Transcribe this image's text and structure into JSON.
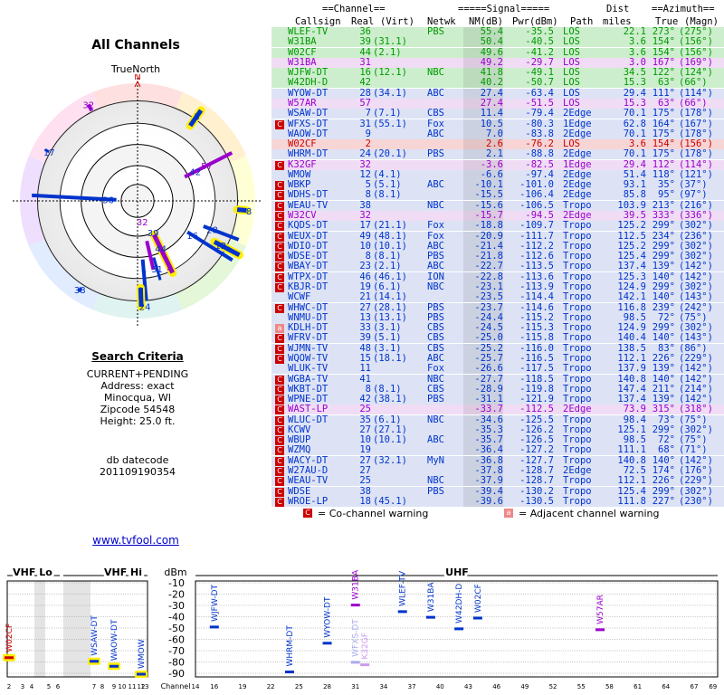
{
  "title": "All Channels",
  "true_north": "TrueNorth",
  "north_letter": "N",
  "search_criteria": {
    "heading": "Search Criteria",
    "lines": [
      "CURRENT+PENDING",
      "Address: exact",
      "Minocqua, WI",
      "Zipcode 54548",
      "Height: 25.0 ft."
    ]
  },
  "db_datecode_label": "db datecode",
  "db_datecode": "201109190354",
  "link": "www.tvfool.com",
  "table_headers": {
    "group_channel": "==Channel==",
    "group_signal": "=====Signal=====",
    "group_dist": "Dist",
    "group_azimuth": "==Azimuth==",
    "callsign": "Callsign",
    "real": "Real",
    "virt": "(Virt)",
    "netwk": "Netwk",
    "nm": "NM(dB)",
    "pwr": "Pwr(dBm)",
    "path": "Path",
    "miles": "miles",
    "true": "True",
    "magn": "(Magn)"
  },
  "legend": {
    "co_mark": "C",
    "co_text": "= Co-channel warning",
    "adj_mark": "a",
    "adj_text": "= Adjacent channel warning"
  },
  "colors": {
    "green": "#009900",
    "blue": "#0033cc",
    "purple": "#9900cc",
    "orange": "#cc6600",
    "red": "#cc0000",
    "olive": "#888800",
    "magenta": "#cc0099"
  },
  "stations": [
    {
      "call": "WLEF-TV",
      "real": "36",
      "virt": "",
      "net": "PBS",
      "nm": "55.4",
      "pwr": "-35.5",
      "path": "LOS",
      "dist": "22.1",
      "az": "273°",
      "mag": "(275°)",
      "color": "#009900",
      "warn": ""
    },
    {
      "call": "W31BA",
      "real": "39",
      "virt": "(31.1)",
      "net": "",
      "nm": "50.4",
      "pwr": "-40.5",
      "path": "LOS",
      "dist": "3.6",
      "az": "154°",
      "mag": "(156°)",
      "color": "#009900",
      "warn": ""
    },
    {
      "call": "W02CF",
      "real": "44",
      "virt": "(2.1)",
      "net": "",
      "nm": "49.6",
      "pwr": "-41.2",
      "path": "LOS",
      "dist": "3.6",
      "az": "154°",
      "mag": "(156°)",
      "color": "#009900",
      "warn": ""
    },
    {
      "call": "W31BA",
      "real": "31",
      "virt": "",
      "net": "",
      "nm": "49.2",
      "pwr": "-29.7",
      "path": "LOS",
      "dist": "3.0",
      "az": "167°",
      "mag": "(169°)",
      "color": "#9900cc",
      "warn": ""
    },
    {
      "call": "WJFW-DT",
      "real": "16",
      "virt": "(12.1)",
      "net": "NBC",
      "nm": "41.8",
      "pwr": "-49.1",
      "path": "LOS",
      "dist": "34.5",
      "az": "122°",
      "mag": "(124°)",
      "color": "#009900",
      "warn": ""
    },
    {
      "call": "W42DH-D",
      "real": "42",
      "virt": "",
      "net": "",
      "nm": "40.2",
      "pwr": "-50.7",
      "path": "LOS",
      "dist": "15.3",
      "az": "63°",
      "mag": "(66°)",
      "color": "#009900",
      "warn": ""
    },
    {
      "call": "WYOW-DT",
      "real": "28",
      "virt": "(34.1)",
      "net": "ABC",
      "nm": "27.4",
      "pwr": "-63.4",
      "path": "LOS",
      "dist": "29.4",
      "az": "111°",
      "mag": "(114°)",
      "color": "#0033cc",
      "warn": ""
    },
    {
      "call": "W57AR",
      "real": "57",
      "virt": "",
      "net": "",
      "nm": "27.4",
      "pwr": "-51.5",
      "path": "LOS",
      "dist": "15.3",
      "az": "63°",
      "mag": "(66°)",
      "color": "#9900cc",
      "warn": ""
    },
    {
      "call": "WSAW-DT",
      "real": "7",
      "virt": "(7.1)",
      "net": "CBS",
      "nm": "11.4",
      "pwr": "-79.4",
      "path": "2Edge",
      "dist": "70.1",
      "az": "175°",
      "mag": "(178°)",
      "color": "#0033cc",
      "warn": ""
    },
    {
      "call": "WFXS-DT",
      "real": "31",
      "virt": "(55.1)",
      "net": "Fox",
      "nm": "10.5",
      "pwr": "-80.3",
      "path": "1Edge",
      "dist": "62.8",
      "az": "164°",
      "mag": "(167°)",
      "color": "#0033cc",
      "warn": "C"
    },
    {
      "call": "WAOW-DT",
      "real": "9",
      "virt": "",
      "net": "ABC",
      "nm": "7.0",
      "pwr": "-83.8",
      "path": "2Edge",
      "dist": "70.1",
      "az": "175°",
      "mag": "(178°)",
      "color": "#0033cc",
      "warn": ""
    },
    {
      "call": "W02CF",
      "real": "2",
      "virt": "",
      "net": "",
      "nm": "2.6",
      "pwr": "-76.2",
      "path": "LOS",
      "dist": "3.6",
      "az": "154°",
      "mag": "(156°)",
      "color": "#cc0000",
      "warn": ""
    },
    {
      "call": "WHRM-DT",
      "real": "24",
      "virt": "(20.1)",
      "net": "PBS",
      "nm": "2.1",
      "pwr": "-88.8",
      "path": "2Edge",
      "dist": "70.1",
      "az": "175°",
      "mag": "(178°)",
      "color": "#0033cc",
      "warn": ""
    },
    {
      "call": "K32GF",
      "real": "32",
      "virt": "",
      "net": "",
      "nm": "-3.6",
      "pwr": "-82.5",
      "path": "1Edge",
      "dist": "29.4",
      "az": "112°",
      "mag": "(114°)",
      "color": "#9900cc",
      "warn": "C"
    },
    {
      "call": "WMOW",
      "real": "12",
      "virt": "(4.1)",
      "net": "",
      "nm": "-6.6",
      "pwr": "-97.4",
      "path": "2Edge",
      "dist": "51.4",
      "az": "118°",
      "mag": "(121°)",
      "color": "#0033cc",
      "warn": ""
    },
    {
      "call": "WBKP",
      "real": "5",
      "virt": "(5.1)",
      "net": "ABC",
      "nm": "-10.1",
      "pwr": "-101.0",
      "path": "2Edge",
      "dist": "93.1",
      "az": "35°",
      "mag": "(37°)",
      "color": "#0033cc",
      "warn": "C"
    },
    {
      "call": "WDHS-DT",
      "real": "8",
      "virt": "(8.1)",
      "net": "",
      "nm": "-15.5",
      "pwr": "-106.4",
      "path": "2Edge",
      "dist": "85.8",
      "az": "95°",
      "mag": "(97°)",
      "color": "#0033cc",
      "warn": "C"
    },
    {
      "call": "WEAU-TV",
      "real": "38",
      "virt": "",
      "net": "NBC",
      "nm": "-15.6",
      "pwr": "-106.5",
      "path": "Tropo",
      "dist": "103.9",
      "az": "213°",
      "mag": "(216°)",
      "color": "#0033cc",
      "warn": "C"
    },
    {
      "call": "W32CV",
      "real": "32",
      "virt": "",
      "net": "",
      "nm": "-15.7",
      "pwr": "-94.5",
      "path": "2Edge",
      "dist": "39.5",
      "az": "333°",
      "mag": "(336°)",
      "color": "#9900cc",
      "warn": "C"
    },
    {
      "call": "KQDS-DT",
      "real": "17",
      "virt": "(21.1)",
      "net": "Fox",
      "nm": "-18.8",
      "pwr": "-109.7",
      "path": "Tropo",
      "dist": "125.2",
      "az": "299°",
      "mag": "(302°)",
      "color": "#0033cc",
      "warn": "C"
    },
    {
      "call": "WEUX-DT",
      "real": "49",
      "virt": "(48.1)",
      "net": "Fox",
      "nm": "-20.9",
      "pwr": "-111.7",
      "path": "Tropo",
      "dist": "112.5",
      "az": "234°",
      "mag": "(236°)",
      "color": "#0033cc",
      "warn": "C"
    },
    {
      "call": "WDIO-DT",
      "real": "10",
      "virt": "(10.1)",
      "net": "ABC",
      "nm": "-21.4",
      "pwr": "-112.2",
      "path": "Tropo",
      "dist": "125.2",
      "az": "299°",
      "mag": "(302°)",
      "color": "#0033cc",
      "warn": "C"
    },
    {
      "call": "WDSE-DT",
      "real": "8",
      "virt": "(8.1)",
      "net": "PBS",
      "nm": "-21.8",
      "pwr": "-112.6",
      "path": "Tropo",
      "dist": "125.4",
      "az": "299°",
      "mag": "(302°)",
      "color": "#0033cc",
      "warn": "C"
    },
    {
      "call": "WBAY-DT",
      "real": "23",
      "virt": "(2.1)",
      "net": "ABC",
      "nm": "-22.7",
      "pwr": "-113.5",
      "path": "Tropo",
      "dist": "137.4",
      "az": "139°",
      "mag": "(142°)",
      "color": "#0033cc",
      "warn": "C"
    },
    {
      "call": "WTPX-DT",
      "real": "46",
      "virt": "(46.1)",
      "net": "ION",
      "nm": "-22.8",
      "pwr": "-113.6",
      "path": "Tropo",
      "dist": "125.3",
      "az": "140°",
      "mag": "(142°)",
      "color": "#0033cc",
      "warn": "C"
    },
    {
      "call": "KBJR-DT",
      "real": "19",
      "virt": "(6.1)",
      "net": "NBC",
      "nm": "-23.1",
      "pwr": "-113.9",
      "path": "Tropo",
      "dist": "124.9",
      "az": "299°",
      "mag": "(302°)",
      "color": "#0033cc",
      "warn": "C"
    },
    {
      "call": "WCWF",
      "real": "21",
      "virt": "(14.1)",
      "net": "",
      "nm": "-23.5",
      "pwr": "-114.4",
      "path": "Tropo",
      "dist": "142.1",
      "az": "140°",
      "mag": "(143°)",
      "color": "#0033cc",
      "warn": ""
    },
    {
      "call": "WHWC-DT",
      "real": "27",
      "virt": "(28.1)",
      "net": "PBS",
      "nm": "-23.7",
      "pwr": "-114.6",
      "path": "Tropo",
      "dist": "116.8",
      "az": "239°",
      "mag": "(242°)",
      "color": "#0033cc",
      "warn": "C"
    },
    {
      "call": "WNMU-DT",
      "real": "13",
      "virt": "(13.1)",
      "net": "PBS",
      "nm": "-24.4",
      "pwr": "-115.2",
      "path": "Tropo",
      "dist": "98.5",
      "az": "72°",
      "mag": "(75°)",
      "color": "#0033cc",
      "warn": ""
    },
    {
      "call": "KDLH-DT",
      "real": "33",
      "virt": "(3.1)",
      "net": "CBS",
      "nm": "-24.5",
      "pwr": "-115.3",
      "path": "Tropo",
      "dist": "124.9",
      "az": "299°",
      "mag": "(302°)",
      "color": "#0033cc",
      "warn": "a"
    },
    {
      "call": "WFRV-DT",
      "real": "39",
      "virt": "(5.1)",
      "net": "CBS",
      "nm": "-25.0",
      "pwr": "-115.8",
      "path": "Tropo",
      "dist": "140.4",
      "az": "140°",
      "mag": "(143°)",
      "color": "#0033cc",
      "warn": "C"
    },
    {
      "call": "WJMN-TV",
      "real": "48",
      "virt": "(3.1)",
      "net": "CBS",
      "nm": "-25.2",
      "pwr": "-116.0",
      "path": "Tropo",
      "dist": "138.5",
      "az": "83°",
      "mag": "(86°)",
      "color": "#0033cc",
      "warn": "C"
    },
    {
      "call": "WQOW-TV",
      "real": "15",
      "virt": "(18.1)",
      "net": "ABC",
      "nm": "-25.7",
      "pwr": "-116.5",
      "path": "Tropo",
      "dist": "112.1",
      "az": "226°",
      "mag": "(229°)",
      "color": "#0033cc",
      "warn": "C"
    },
    {
      "call": "WLUK-TV",
      "real": "11",
      "virt": "",
      "net": "Fox",
      "nm": "-26.6",
      "pwr": "-117.5",
      "path": "Tropo",
      "dist": "137.9",
      "az": "139°",
      "mag": "(142°)",
      "color": "#0033cc",
      "warn": ""
    },
    {
      "call": "WGBA-TV",
      "real": "41",
      "virt": "",
      "net": "NBC",
      "nm": "-27.7",
      "pwr": "-118.5",
      "path": "Tropo",
      "dist": "140.8",
      "az": "140°",
      "mag": "(142°)",
      "color": "#0033cc",
      "warn": "C"
    },
    {
      "call": "WKBT-DT",
      "real": "8",
      "virt": "(8.1)",
      "net": "CBS",
      "nm": "-28.9",
      "pwr": "-119.8",
      "path": "Tropo",
      "dist": "147.4",
      "az": "211°",
      "mag": "(214°)",
      "color": "#0033cc",
      "warn": "C"
    },
    {
      "call": "WPNE-DT",
      "real": "42",
      "virt": "(38.1)",
      "net": "PBS",
      "nm": "-31.1",
      "pwr": "-121.9",
      "path": "Tropo",
      "dist": "137.4",
      "az": "139°",
      "mag": "(142°)",
      "color": "#0033cc",
      "warn": "C"
    },
    {
      "call": "WAST-LP",
      "real": "25",
      "virt": "",
      "net": "",
      "nm": "-33.7",
      "pwr": "-112.5",
      "path": "2Edge",
      "dist": "73.9",
      "az": "315°",
      "mag": "(318°)",
      "color": "#9900cc",
      "warn": "C"
    },
    {
      "call": "WLUC-DT",
      "real": "35",
      "virt": "(6.1)",
      "net": "NBC",
      "nm": "-34.6",
      "pwr": "-125.5",
      "path": "Tropo",
      "dist": "98.4",
      "az": "73°",
      "mag": "(75°)",
      "color": "#0033cc",
      "warn": "C"
    },
    {
      "call": "KCWV",
      "real": "27",
      "virt": "(27.1)",
      "net": "",
      "nm": "-35.3",
      "pwr": "-126.2",
      "path": "Tropo",
      "dist": "125.1",
      "az": "299°",
      "mag": "(302°)",
      "color": "#0033cc",
      "warn": "C"
    },
    {
      "call": "WBUP",
      "real": "10",
      "virt": "(10.1)",
      "net": "ABC",
      "nm": "-35.7",
      "pwr": "-126.5",
      "path": "Tropo",
      "dist": "98.5",
      "az": "72°",
      "mag": "(75°)",
      "color": "#0033cc",
      "warn": "C"
    },
    {
      "call": "WZMQ",
      "real": "19",
      "virt": "",
      "net": "",
      "nm": "-36.4",
      "pwr": "-127.2",
      "path": "Tropo",
      "dist": "111.1",
      "az": "68°",
      "mag": "(71°)",
      "color": "#0033cc",
      "warn": "C"
    },
    {
      "call": "WACY-DT",
      "real": "27",
      "virt": "(32.1)",
      "net": "MyN",
      "nm": "-36.8",
      "pwr": "-127.7",
      "path": "Tropo",
      "dist": "140.8",
      "az": "140°",
      "mag": "(142°)",
      "color": "#0033cc",
      "warn": "C"
    },
    {
      "call": "W27AU-D",
      "real": "27",
      "virt": "",
      "net": "",
      "nm": "-37.8",
      "pwr": "-128.7",
      "path": "2Edge",
      "dist": "72.5",
      "az": "174°",
      "mag": "(176°)",
      "color": "#0033cc",
      "warn": "C"
    },
    {
      "call": "WEAU-TV",
      "real": "25",
      "virt": "",
      "net": "NBC",
      "nm": "-37.9",
      "pwr": "-128.7",
      "path": "Tropo",
      "dist": "112.1",
      "az": "226°",
      "mag": "(229°)",
      "color": "#0033cc",
      "warn": "C"
    },
    {
      "call": "WDSE",
      "real": "38",
      "virt": "",
      "net": "PBS",
      "nm": "-39.4",
      "pwr": "-130.2",
      "path": "Tropo",
      "dist": "125.4",
      "az": "299°",
      "mag": "(302°)",
      "color": "#0033cc",
      "warn": "C"
    },
    {
      "call": "WROE-LP",
      "real": "18",
      "virt": "(45.1)",
      "net": "",
      "nm": "-39.6",
      "pwr": "-130.5",
      "path": "Tropo",
      "dist": "111.8",
      "az": "227°",
      "mag": "(230°)",
      "color": "#0033cc",
      "warn": "C"
    }
  ],
  "polar_labels": [
    {
      "label": "32",
      "az": 333,
      "r": 0.92,
      "color": "#9900cc"
    },
    {
      "label": "5",
      "az": 35,
      "r": 0.88,
      "color": "#0033cc"
    },
    {
      "label": "17",
      "az": 299,
      "r": 0.86,
      "color": "#0033cc"
    },
    {
      "label": "42",
      "az": 63,
      "r": 0.55,
      "color": "#0033cc"
    },
    {
      "label": "57",
      "az": 63,
      "r": 0.66,
      "color": "#9900cc"
    },
    {
      "label": "36",
      "az": 273,
      "r": 0.25,
      "color": "#0033cc"
    },
    {
      "label": "8",
      "az": 95,
      "r": 0.95,
      "color": "#0033cc"
    },
    {
      "label": "16",
      "az": 122,
      "r": 0.55,
      "color": "#0033cc"
    },
    {
      "label": "28",
      "az": 111,
      "r": 0.68,
      "color": "#0033cc"
    },
    {
      "label": "12",
      "az": 118,
      "r": 0.8,
      "color": "#0033cc"
    },
    {
      "label": "32",
      "az": 167,
      "r": 0.18,
      "color": "#9900cc"
    },
    {
      "label": "39",
      "az": 154,
      "r": 0.3,
      "color": "#0033cc"
    },
    {
      "label": "44",
      "az": 154,
      "r": 0.45,
      "color": "#0033cc"
    },
    {
      "label": "38",
      "az": 213,
      "r": 0.9,
      "color": "#0033cc"
    },
    {
      "label": "7",
      "az": 175,
      "r": 0.62,
      "color": "#0033cc"
    },
    {
      "label": "31",
      "az": 164,
      "r": 0.6,
      "color": "#0033cc"
    },
    {
      "label": "2",
      "az": 154,
      "r": 0.62,
      "color": "#9900cc"
    },
    {
      "label": "9",
      "az": 178,
      "r": 0.76,
      "color": "#0033cc"
    },
    {
      "label": "24",
      "az": 176,
      "r": 0.9,
      "color": "#0033cc"
    }
  ],
  "chart_data": {
    "type": "bar",
    "ylabel": "dBm",
    "ylim": [
      -90,
      -10
    ],
    "yticks": [
      -10,
      -20,
      -30,
      -40,
      -50,
      -60,
      -70,
      -80,
      -90
    ],
    "x_label": "Channel",
    "sections": [
      {
        "label": "VHF Lo",
        "channels": [
          2,
          3,
          4,
          5,
          6
        ]
      },
      {
        "label": "VHF Hi",
        "channels": [
          7,
          8,
          9,
          10,
          11,
          12,
          13
        ]
      },
      {
        "label": "UHF",
        "channels": [
          14,
          16,
          19,
          22,
          25,
          28,
          31,
          34,
          37,
          40,
          43,
          46,
          49,
          52,
          55,
          58,
          61,
          64,
          67,
          69
        ]
      }
    ],
    "points": [
      {
        "call": "W02CF",
        "ch": 2,
        "dbm": -76.2,
        "color": "#cc0000"
      },
      {
        "call": "WSAW-DT",
        "ch": 7,
        "dbm": -79.4,
        "color": "#0033cc"
      },
      {
        "call": "WAOW-DT",
        "ch": 9,
        "dbm": -83.8,
        "color": "#0033cc"
      },
      {
        "call": "WMOW",
        "ch": 12,
        "dbm": -97.4,
        "color": "#0033cc"
      },
      {
        "call": "WJFW-DT",
        "ch": 16,
        "dbm": -49.1,
        "color": "#0033cc"
      },
      {
        "call": "WHRM-DT",
        "ch": 24,
        "dbm": -88.8,
        "color": "#0033cc"
      },
      {
        "call": "WYOW-DT",
        "ch": 28,
        "dbm": -63.4,
        "color": "#0033cc"
      },
      {
        "call": "W31BA",
        "ch": 31,
        "dbm": -29.7,
        "color": "#9900cc"
      },
      {
        "call": "WFXS-DT",
        "ch": 31,
        "dbm": -80.3,
        "color": "#aaaaee"
      },
      {
        "call": "K32GF",
        "ch": 32,
        "dbm": -82.5,
        "color": "#cc99ee"
      },
      {
        "call": "WLEF-TV",
        "ch": 36,
        "dbm": -35.5,
        "color": "#0033cc"
      },
      {
        "call": "W31BA",
        "ch": 39,
        "dbm": -40.5,
        "color": "#0033cc"
      },
      {
        "call": "W42DH-D",
        "ch": 42,
        "dbm": -50.7,
        "color": "#0033cc"
      },
      {
        "call": "W02CF",
        "ch": 44,
        "dbm": -41.2,
        "color": "#0033cc"
      },
      {
        "call": "W57AR",
        "ch": 57,
        "dbm": -51.5,
        "color": "#9900cc"
      }
    ]
  }
}
